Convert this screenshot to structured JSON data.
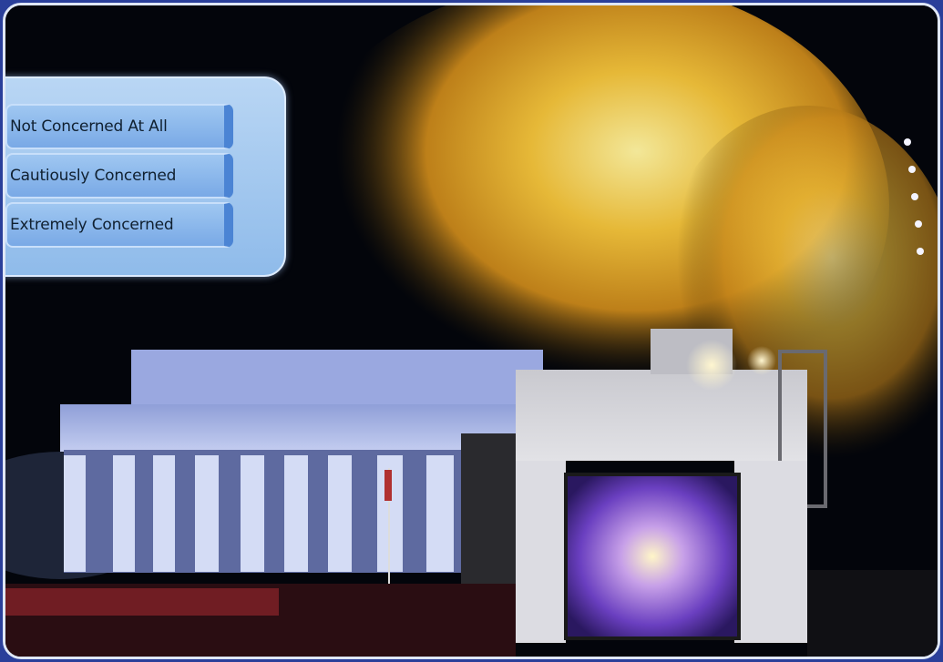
{
  "quiz": {
    "options": [
      {
        "label": "Not Concerned At All"
      },
      {
        "label": "Cautiously Concerned"
      },
      {
        "label": "Extremely Concerned"
      }
    ]
  },
  "photo": {
    "subject": "monument-fireworks-night-scene",
    "colors": {
      "sky": "#04060c",
      "fireworks": "#e8a21a",
      "stone": "#a9b6e8",
      "screen": "#7a5fd0"
    }
  }
}
